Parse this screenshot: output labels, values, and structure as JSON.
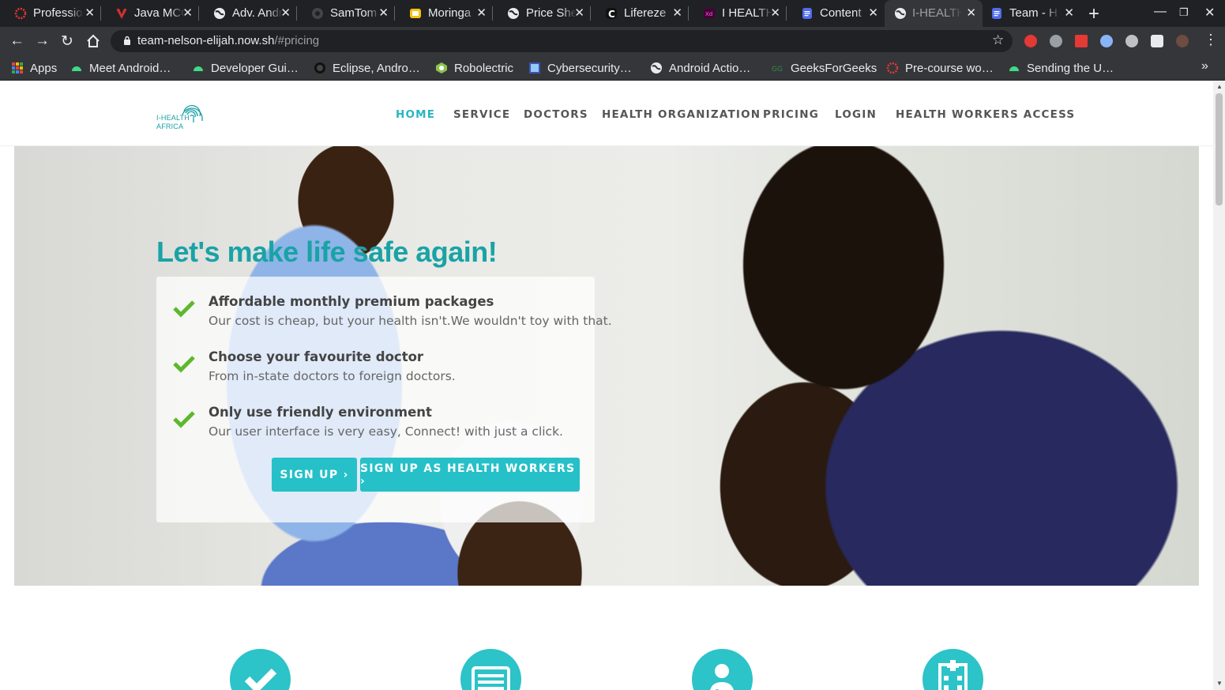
{
  "browser": {
    "tabs": [
      {
        "title": "Professio",
        "icon_color": "#e53935",
        "icon": "opera-dotted-icon"
      },
      {
        "title": "Java MCQ",
        "icon_color": "#d32f2f",
        "icon": "v-logo-icon"
      },
      {
        "title": "Adv. Andr",
        "icon_color": "#e8eaed",
        "icon": "globe-icon"
      },
      {
        "title": "SamTom",
        "icon_color": "#444",
        "icon": "github-icon"
      },
      {
        "title": "Moringa",
        "icon_color": "#f4c20d",
        "icon": "slides-icon"
      },
      {
        "title": "Price She",
        "icon_color": "#e8eaed",
        "icon": "globe-icon"
      },
      {
        "title": "Lifereze",
        "icon_color": "#111",
        "icon": "c-logo-icon"
      },
      {
        "title": "I HEALTH",
        "icon_color": "#a0146b",
        "icon": "xd-icon"
      },
      {
        "title": "Content",
        "icon_color": "#4f6bed",
        "icon": "docs-icon"
      },
      {
        "title": "I-HEALTH",
        "icon_color": "#e8eaed",
        "icon": "globe-icon",
        "active": true
      },
      {
        "title": "Team - H",
        "icon_color": "#4f6bed",
        "icon": "docs-icon"
      }
    ],
    "url_host": "team-nelson-elijah.now.sh",
    "url_path": "/#pricing",
    "bookmarks": [
      {
        "label": "Apps",
        "icon": "apps-grid-icon"
      },
      {
        "label": "Meet Android…",
        "icon": "android-icon"
      },
      {
        "label": "Developer Gui…",
        "icon": "android-icon"
      },
      {
        "label": "Eclipse, Andro…",
        "icon": "eclipse-icon"
      },
      {
        "label": "Robolectric",
        "icon": "robolectric-icon"
      },
      {
        "label": "Cybersecurity…",
        "icon": "cyber-icon"
      },
      {
        "label": "Android Actio…",
        "icon": "globe-icon"
      },
      {
        "label": "GeeksForGeeks",
        "icon": "gfg-icon"
      },
      {
        "label": "Pre-course wo…",
        "icon": "dotted-circle-icon"
      },
      {
        "label": "Sending the U…",
        "icon": "android-icon"
      }
    ]
  },
  "site": {
    "logo_line1": "I-HEALTH",
    "logo_line2": "AFRICA",
    "nav": [
      "HOME",
      "SERVICE",
      "DOCTORS",
      "HEALTH ORGANIZATION",
      "PRICING",
      "LOGIN",
      "HEALTH WORKERS ACCESS"
    ],
    "hero_title": "Let's make life safe again!",
    "features": [
      {
        "title": "Affordable monthly premium packages",
        "desc": "Our cost is cheap, but your health isn't.We wouldn't toy with that."
      },
      {
        "title": "Choose your favourite doctor",
        "desc": "From in-state doctors to foreign doctors."
      },
      {
        "title": "Only use friendly environment",
        "desc": "Our user interface is very easy, Connect! with just a click."
      }
    ],
    "signup_label": "SIGN UP ›",
    "signup_workers_label": "SIGN UP AS HEALTH WORKERS ›",
    "service_icons": [
      "checkmark-icon",
      "list-card-icon",
      "doctor-icon",
      "hospital-icon"
    ],
    "colors": {
      "accent": "#26c0c8",
      "title": "#19a3a6",
      "check": "#5cb82d"
    }
  }
}
